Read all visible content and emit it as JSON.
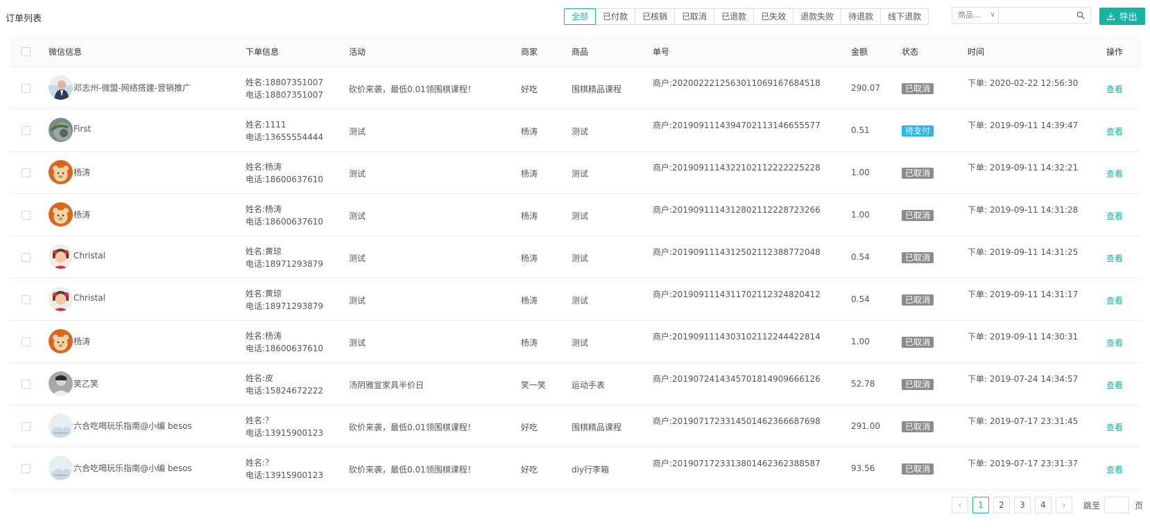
{
  "page": {
    "title": "订单列表"
  },
  "filters": [
    {
      "label": "全部",
      "active": true
    },
    {
      "label": "已付款",
      "active": false
    },
    {
      "label": "已核销",
      "active": false
    },
    {
      "label": "已取消",
      "active": false
    },
    {
      "label": "已退款",
      "active": false
    },
    {
      "label": "已失效",
      "active": false
    },
    {
      "label": "退款失败",
      "active": false
    },
    {
      "label": "待退款",
      "active": false
    },
    {
      "label": "线下退款",
      "active": false
    }
  ],
  "search": {
    "select_value": "商品...",
    "input_value": ""
  },
  "toolbar": {
    "export_label": "导出"
  },
  "colors": {
    "accent": "#17b3a3",
    "cancelled": "#8c8c8c",
    "pending": "#29b6f6"
  },
  "table": {
    "headers": {
      "wechat": "微信信息",
      "order_info": "下单信息",
      "activity": "活动",
      "merchant": "商家",
      "product": "商品",
      "order_no": "单号",
      "amount": "金额",
      "status": "状态",
      "time": "时间",
      "action": "操作"
    },
    "rows": [
      {
        "avatar": "man-suit",
        "wx_name": "邓志州-微盟-网络搭建-营销推广",
        "name_line": "姓名:18807351007",
        "phone_line": "电话:18807351007",
        "activity": "砍价来袭，最低0.01领围棋课程！",
        "merchant": "好吃",
        "product": "围棋精品课程",
        "order_no": "商户:202002221256301106916768451​8",
        "amount": "290.07",
        "status": "已取消",
        "status_type": "cancelled",
        "time": "下单: 2020-02-22 12:56:30",
        "action": "查看"
      },
      {
        "avatar": "bird-gray",
        "wx_name": "First",
        "name_line": "姓名:1111",
        "phone_line": "电话:13655554444",
        "activity": "测试",
        "merchant": "杨涛",
        "product": "测试",
        "order_no": "商户:2019091114394702113146655577",
        "amount": "0.51",
        "status": "待支付",
        "status_type": "pending",
        "time": "下单: 2019-09-11 14:39:47",
        "action": "查看"
      },
      {
        "avatar": "bear-orange",
        "wx_name": "杨涛",
        "name_line": "姓名:杨涛",
        "phone_line": "电话:18600637610",
        "activity": "测试",
        "merchant": "杨涛",
        "product": "测试",
        "order_no": "商户:2019091114322102112222225228",
        "amount": "1.00",
        "status": "已取消",
        "status_type": "cancelled",
        "time": "下单: 2019-09-11 14:32:21",
        "action": "查看"
      },
      {
        "avatar": "bear-orange",
        "wx_name": "杨涛",
        "name_line": "姓名:杨涛",
        "phone_line": "电话:18600637610",
        "activity": "测试",
        "merchant": "杨涛",
        "product": "测试",
        "order_no": "商户:2019091114312802112228723266",
        "amount": "1.00",
        "status": "已取消",
        "status_type": "cancelled",
        "time": "下单: 2019-09-11 14:31:28",
        "action": "查看"
      },
      {
        "avatar": "child-red",
        "wx_name": "Christal",
        "name_line": "姓名:黄琼",
        "phone_line": "电话:18971293879",
        "activity": "测试",
        "merchant": "杨涛",
        "product": "测试",
        "order_no": "商户:2019091114312502112388772048",
        "amount": "0.54",
        "status": "已取消",
        "status_type": "cancelled",
        "time": "下单: 2019-09-11 14:31:25",
        "action": "查看"
      },
      {
        "avatar": "child-red",
        "wx_name": "Christal",
        "name_line": "姓名:黄琼",
        "phone_line": "电话:18971293879",
        "activity": "测试",
        "merchant": "杨涛",
        "product": "测试",
        "order_no": "商户:2019091114311702112324820412",
        "amount": "0.54",
        "status": "已取消",
        "status_type": "cancelled",
        "time": "下单: 2019-09-11 14:31:17",
        "action": "查看"
      },
      {
        "avatar": "bear-orange",
        "wx_name": "杨涛",
        "name_line": "姓名:杨涛",
        "phone_line": "电话:18600637610",
        "activity": "测试",
        "merchant": "杨涛",
        "product": "测试",
        "order_no": "商户:2019091114303102112244422814",
        "amount": "1.00",
        "status": "已取消",
        "status_type": "cancelled",
        "time": "下单: 2019-09-11 14:30:31",
        "action": "查看"
      },
      {
        "avatar": "person-gray",
        "wx_name": "笑乙笑",
        "name_line": "姓名:皮",
        "phone_line": "电话:15824672222",
        "activity": "汤阴雅宣家具半价日",
        "merchant": "笑一笑",
        "product": "运动手表",
        "order_no": "商户:2019072414345701814909666126",
        "amount": "52.78",
        "status": "已取消",
        "status_type": "cancelled",
        "time": "下单: 2019-07-24 14:34:57",
        "action": "查看"
      },
      {
        "avatar": "logo-light",
        "wx_name": "六合吃喝玩乐指南@小编 besos",
        "name_line": "姓名:？",
        "phone_line": "电话:13915900123",
        "activity": "砍价来袭，最低0.01领围棋课程！",
        "merchant": "好吃",
        "product": "围棋精品课程",
        "order_no": "商户:2019071723314501462366687698",
        "amount": "291.00",
        "status": "已取消",
        "status_type": "cancelled",
        "time": "下单: 2019-07-17 23:31:45",
        "action": "查看"
      },
      {
        "avatar": "logo-light",
        "wx_name": "六合吃喝玩乐指南@小编 besos",
        "name_line": "姓名:？",
        "phone_line": "电话:13915900123",
        "activity": "砍价来袭，最低0.01领围棋课程！",
        "merchant": "好吃",
        "product": "diy行李箱",
        "order_no": "商户:2019071723313801462362388587",
        "amount": "93.56",
        "status": "已取消",
        "status_type": "cancelled",
        "time": "下单: 2019-07-17 23:31:37",
        "action": "查看"
      }
    ]
  },
  "pagination": {
    "prev": "‹",
    "next": "›",
    "pages": [
      "1",
      "2",
      "3",
      "4"
    ],
    "current": "1",
    "jump_label": "跳至",
    "page_suffix": "页"
  }
}
